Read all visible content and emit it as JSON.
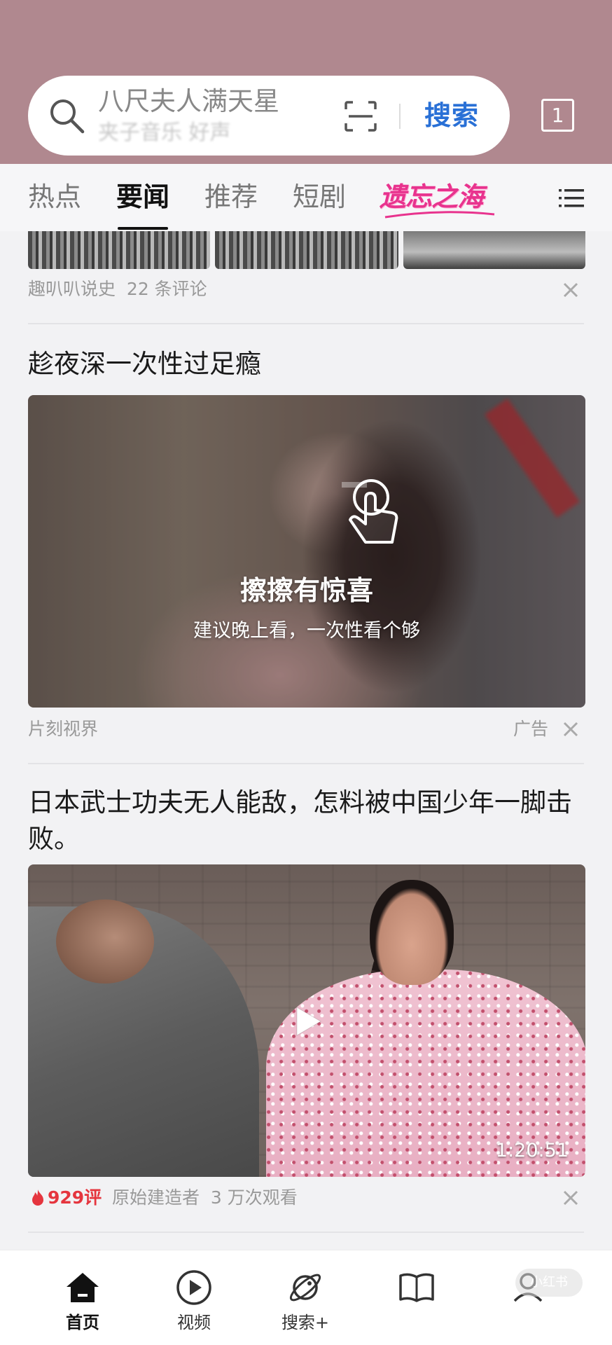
{
  "header": {
    "search_placeholder": "八尺夫人满天星",
    "search_placeholder_next": "夹子音乐 好声",
    "search_button": "搜索",
    "tabs_count": "1",
    "colors": {
      "background": "#b0888f",
      "accent": "#2970d6"
    }
  },
  "channels": {
    "items": [
      {
        "label": "热点"
      },
      {
        "label": "要闻"
      },
      {
        "label": "推荐"
      },
      {
        "label": "短剧"
      }
    ],
    "active_index": 1,
    "special": "遗忘之海"
  },
  "feed": {
    "item1": {
      "source": "趣叭叭说史",
      "comments": "22 条评论"
    },
    "item2": {
      "title": "趁夜深一次性过足瘾",
      "headline": "擦擦有惊喜",
      "subline": "建议晚上看，一次性看个够",
      "source": "片刻视界",
      "ad_label": "广告"
    },
    "item3": {
      "title": "日本武士功夫无人能敌，怎料被中国少年一脚击败。",
      "duration": "1:20:51",
      "comments": "929评",
      "author": "原始建造者",
      "views": "3 万次观看"
    }
  },
  "bottom_nav": {
    "items": [
      {
        "label": "首页",
        "icon": "home-icon"
      },
      {
        "label": "视频",
        "icon": "video-play-icon"
      },
      {
        "label": "搜索+",
        "icon": "planet-search-icon"
      },
      {
        "label": "",
        "icon": "book-icon"
      },
      {
        "label": "",
        "icon": "profile-icon"
      }
    ],
    "watermark": "小红书"
  }
}
